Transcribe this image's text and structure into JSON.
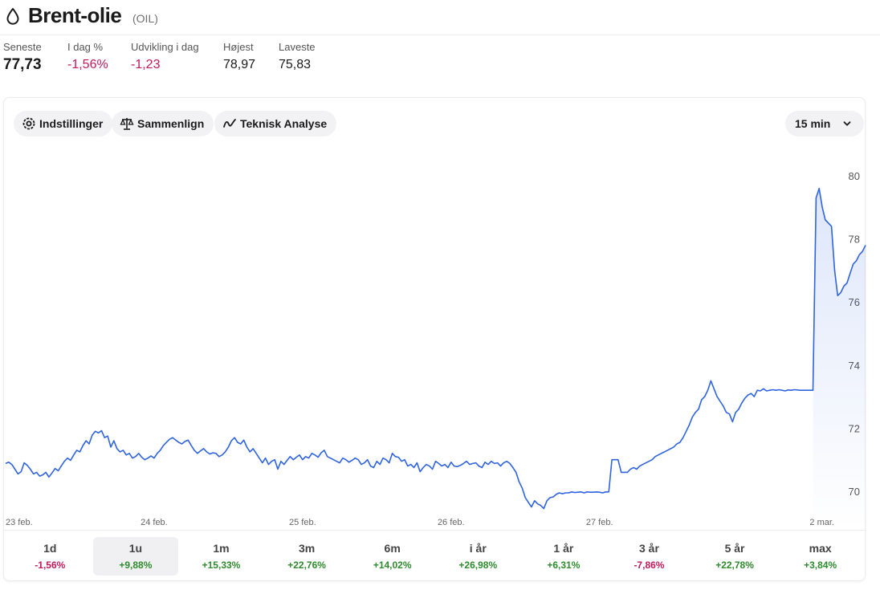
{
  "header": {
    "title": "Brent-olie",
    "ticker": "(OIL)",
    "icon": "droplet-icon"
  },
  "stats": {
    "last": {
      "label": "Seneste",
      "value": "77,73"
    },
    "today_pct": {
      "label": "I dag %",
      "value": "-1,56%"
    },
    "change_today": {
      "label": "Udvikling i dag",
      "value": "-1,23"
    },
    "high": {
      "label": "Højest",
      "value": "78,97"
    },
    "low": {
      "label": "Laveste",
      "value": "75,83"
    }
  },
  "toolbar": {
    "settings": "Indstillinger",
    "compare": "Sammenlign",
    "technical": "Teknisk Analyse",
    "interval": "15 min"
  },
  "colors": {
    "line": "#2f63e0",
    "negative": "#c2185b",
    "positive": "#2e8b2e"
  },
  "chart_data": {
    "type": "area",
    "ylim": [
      69,
      81
    ],
    "yticks": [
      "80",
      "78",
      "76",
      "74",
      "72",
      "70"
    ],
    "ytick_values": [
      80,
      78,
      76,
      74,
      72,
      70
    ],
    "xtick_labels": [
      "23 feb.",
      "24 feb.",
      "25 feb.",
      "26 feb.",
      "27 feb.",
      "2 mar."
    ],
    "xtick_index": [
      0,
      48,
      96,
      144,
      192,
      255
    ],
    "x_axis_note": "15 min bars, index positions",
    "values": [
      70.88,
      70.92,
      70.85,
      70.7,
      70.55,
      70.62,
      70.9,
      70.82,
      70.7,
      70.55,
      70.6,
      70.48,
      70.52,
      70.6,
      70.45,
      70.58,
      70.72,
      70.65,
      70.8,
      70.95,
      71.05,
      70.98,
      71.15,
      71.3,
      71.25,
      71.45,
      71.6,
      71.5,
      71.78,
      71.9,
      71.85,
      71.92,
      71.7,
      71.75,
      71.4,
      71.6,
      71.35,
      71.25,
      71.3,
      71.15,
      71.2,
      71.05,
      71.1,
      71.2,
      71.08,
      71.0,
      71.05,
      71.12,
      71.05,
      71.2,
      71.3,
      71.45,
      71.55,
      71.65,
      71.7,
      71.62,
      71.55,
      71.5,
      71.58,
      71.62,
      71.45,
      71.3,
      71.2,
      71.28,
      71.35,
      71.25,
      71.18,
      71.22,
      71.2,
      71.1,
      71.15,
      71.25,
      71.4,
      71.6,
      71.7,
      71.55,
      71.5,
      71.62,
      71.4,
      71.25,
      71.35,
      71.2,
      71.05,
      70.9,
      71.05,
      70.85,
      70.95,
      71.0,
      70.7,
      70.95,
      70.85,
      70.98,
      71.1,
      71.0,
      71.08,
      71.15,
      71.0,
      71.1,
      71.05,
      71.2,
      71.15,
      71.08,
      71.22,
      71.3,
      71.1,
      71.05,
      71.0,
      70.95,
      70.9,
      71.05,
      71.0,
      70.92,
      70.98,
      71.05,
      71.0,
      70.85,
      70.9,
      71.0,
      70.8,
      70.75,
      70.95,
      70.85,
      71.05,
      71.0,
      70.9,
      71.2,
      71.1,
      71.08,
      70.95,
      71.0,
      70.8,
      70.85,
      70.75,
      70.9,
      70.62,
      70.75,
      70.85,
      70.8,
      70.7,
      70.95,
      70.88,
      70.8,
      70.85,
      70.75,
      70.92,
      70.8,
      70.78,
      70.82,
      70.88,
      70.95,
      70.85,
      70.88,
      70.9,
      70.8,
      70.75,
      70.92,
      70.85,
      70.95,
      70.88,
      70.9,
      70.8,
      70.9,
      70.95,
      70.88,
      70.75,
      70.6,
      70.3,
      70.1,
      69.8,
      69.65,
      69.5,
      69.7,
      69.6,
      69.55,
      69.45,
      69.7,
      69.8,
      69.82,
      69.9,
      69.95,
      69.92,
      69.95,
      69.95,
      69.98,
      69.96,
      69.97,
      69.98,
      69.95,
      69.98,
      69.97,
      69.97,
      69.98,
      69.97,
      69.95,
      69.98,
      69.98,
      71.0,
      71.0,
      71.0,
      70.6,
      70.6,
      70.6,
      70.7,
      70.75,
      70.7,
      70.8,
      70.85,
      70.9,
      70.95,
      71.0,
      71.1,
      71.15,
      71.2,
      71.25,
      71.3,
      71.35,
      71.4,
      71.5,
      71.55,
      71.7,
      71.9,
      72.1,
      72.35,
      72.5,
      72.6,
      72.9,
      73.0,
      73.2,
      73.5,
      73.25,
      73.0,
      72.85,
      72.7,
      72.5,
      72.45,
      72.2,
      72.5,
      72.6,
      72.8,
      72.95,
      73.05,
      73.1,
      73.0,
      73.2,
      73.18,
      73.25,
      73.18,
      73.2,
      73.22,
      73.2,
      73.22,
      73.2,
      73.18,
      73.21,
      73.2,
      73.22,
      73.21,
      73.2,
      73.2,
      73.2,
      73.2,
      73.2,
      79.3,
      79.6,
      79.0,
      78.6,
      78.5,
      78.4,
      77.0,
      76.2,
      76.3,
      76.5,
      76.6,
      76.9,
      77.2,
      77.3,
      77.5,
      77.6,
      77.8
    ]
  },
  "ranges": [
    {
      "label": "1d",
      "change": "-1,56%",
      "sign": "neg",
      "active": false
    },
    {
      "label": "1u",
      "change": "+9,88%",
      "sign": "pos",
      "active": true
    },
    {
      "label": "1m",
      "change": "+15,33%",
      "sign": "pos",
      "active": false
    },
    {
      "label": "3m",
      "change": "+22,76%",
      "sign": "pos",
      "active": false
    },
    {
      "label": "6m",
      "change": "+14,02%",
      "sign": "pos",
      "active": false
    },
    {
      "label": "i år",
      "change": "+26,98%",
      "sign": "pos",
      "active": false
    },
    {
      "label": "1 år",
      "change": "+6,31%",
      "sign": "pos",
      "active": false
    },
    {
      "label": "3 år",
      "change": "-7,86%",
      "sign": "neg",
      "active": false
    },
    {
      "label": "5 år",
      "change": "+22,78%",
      "sign": "pos",
      "active": false
    },
    {
      "label": "max",
      "change": "+3,84%",
      "sign": "pos",
      "active": false
    }
  ]
}
